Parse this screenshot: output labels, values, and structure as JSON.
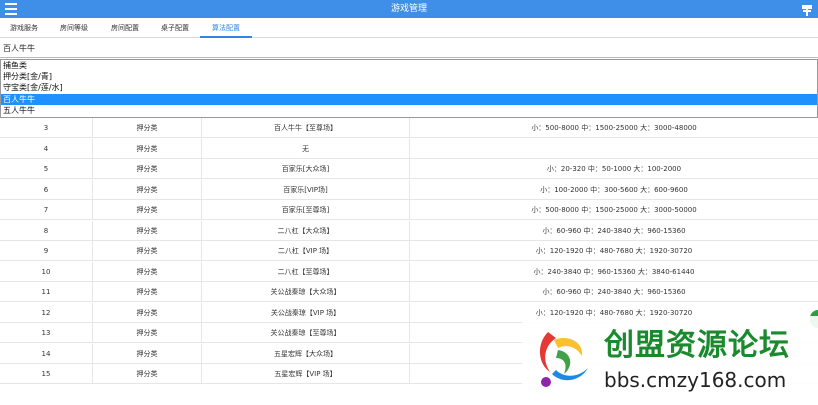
{
  "header": {
    "title": "游戏管理",
    "menu_icon": "hamburger-icon",
    "right_icon": "tray-icon"
  },
  "tabs": [
    {
      "label": "游戏服务"
    },
    {
      "label": "房间等级"
    },
    {
      "label": "房间配置"
    },
    {
      "label": "桌子配置"
    },
    {
      "label": "算法配置",
      "active": true
    }
  ],
  "select": {
    "value": "百人牛牛"
  },
  "dropdown": {
    "options": [
      "捕鱼类",
      "押分类[金/青]",
      "守宝类[金/莲/水]",
      "百人牛牛",
      "五人牛牛"
    ],
    "selected_index": 3
  },
  "table": {
    "rows": [
      {
        "id": "3",
        "type": "押分类",
        "name": "百人牛牛【至尊场】",
        "range": "小：500-8000 中：1500-25000 大：3000-48000"
      },
      {
        "id": "4",
        "type": "押分类",
        "name": "无",
        "range": ""
      },
      {
        "id": "5",
        "type": "押分类",
        "name": "百家乐[大众场]",
        "range": "小：20-320 中：50-1000 大：100-2000"
      },
      {
        "id": "6",
        "type": "押分类",
        "name": "百家乐[VIP场]",
        "range": "小：100-2000 中：300-5600 大：600-9600"
      },
      {
        "id": "7",
        "type": "押分类",
        "name": "百家乐[至尊场]",
        "range": "小：500-8000 中：1500-25000 大：3000-50000"
      },
      {
        "id": "8",
        "type": "押分类",
        "name": "二八杠【大众场】",
        "range": "小：60-960 中：240-3840 大：960-15360"
      },
      {
        "id": "9",
        "type": "押分类",
        "name": "二八杠【VIP 场】",
        "range": "小：120-1920 中：480-7680 大：1920-30720"
      },
      {
        "id": "10",
        "type": "押分类",
        "name": "二八杠【至尊场】",
        "range": "小：240-3840 中：960-15360 大：3840-61440"
      },
      {
        "id": "11",
        "type": "押分类",
        "name": "关公战秦琼【大众场】",
        "range": "小：60-960 中：240-3840 大：960-15360"
      },
      {
        "id": "12",
        "type": "押分类",
        "name": "关公战秦琼【VIP 场】",
        "range": "小：120-1920 中：480-7680 大：1920-30720"
      },
      {
        "id": "13",
        "type": "押分类",
        "name": "关公战秦琼【至尊场】",
        "range": ""
      },
      {
        "id": "14",
        "type": "押分类",
        "name": "五星宏辉【大众场】",
        "range": ""
      },
      {
        "id": "15",
        "type": "押分类",
        "name": "五星宏辉【VIP 场】",
        "range": ""
      }
    ]
  },
  "watermark": {
    "cn": "创盟资源论坛",
    "url": "bbs.cmzy168.com"
  },
  "colors": {
    "header": "#3f8fe8",
    "accent": "#2f86e6",
    "selected": "#1e90ff",
    "watermark_green": "#1b8a2e"
  }
}
